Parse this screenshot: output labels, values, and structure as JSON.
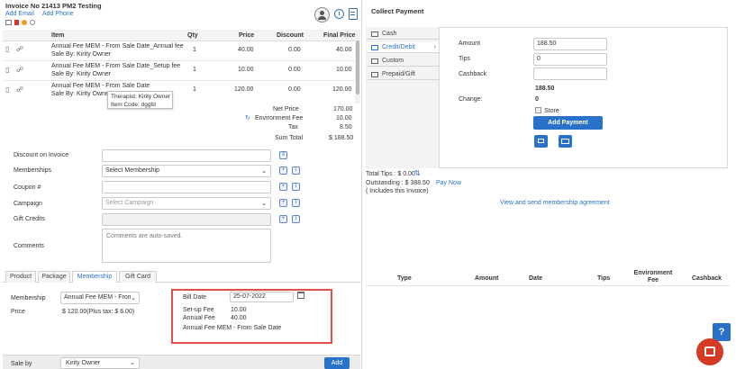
{
  "invoice": {
    "title": "Invoice No 21413  PM2 Testing",
    "add_email": "Add Email",
    "add_phone": "Add Phone"
  },
  "table": {
    "headers": {
      "item": "Item",
      "qty": "Qty",
      "price": "Price",
      "discount": "Discount",
      "final_price": "Final Price"
    },
    "rows": [
      {
        "item": "Annual Fee MEM - From Sale Date_Annual fee",
        "sale_by": "Sale By: Kirity Owner",
        "qty": "1",
        "price": "40.00",
        "discount": "0.00",
        "final": "40.00"
      },
      {
        "item": "Annual Fee MEM - From Sale Date_Setup fee",
        "sale_by": "Sale By: Kirity Owner",
        "qty": "1",
        "price": "10.00",
        "discount": "0.00",
        "final": "10.00"
      },
      {
        "item": "Annual Fee MEM - From Sale Date",
        "sale_by": "Sale By: Kirity Owner",
        "qty": "1",
        "price": "120.00",
        "discount": "0.00",
        "final": "120.00"
      }
    ],
    "tooltip": {
      "line1": "Therapist: Kirity Owner",
      "line2": "Item Code: dggfd"
    }
  },
  "totals": {
    "net_price_label": "Net Price",
    "net_price": "170.00",
    "env_fee_label": "Environment Fee",
    "env_fee": "10.00",
    "tax_label": "Tax",
    "tax": "8.50",
    "sum_total_label": "Sum Total",
    "sum_total": "$ 188.50"
  },
  "form": {
    "discount_label": "Discount on Invoice",
    "memberships_label": "Memberships",
    "memberships_value": "Select Membership",
    "coupon_label": "Coupon #",
    "campaign_label": "Campaign",
    "campaign_placeholder": "Select Campaign",
    "gift_credits_label": "Gift Credits",
    "comments_label": "Comments",
    "comments_placeholder": "Comments are auto-saved."
  },
  "tabs": [
    "Product",
    "Package",
    "Membership",
    "Gift Card"
  ],
  "membership": {
    "membership_label": "Membership",
    "membership_value": "Annual Fee MEM - From",
    "price_label": "Price",
    "price_value": "$ 120.00(Plus tax: $ 6.00)",
    "bill_date_label": "Bill Date",
    "bill_date_value": "25-07-2022",
    "setup_fee_label": "Set-up Fee",
    "setup_fee_value": "10.00",
    "annual_fee_label": "Annual Fee",
    "annual_fee_value": "40.00",
    "plan_name": "Annual Fee MEM - From Sale Date"
  },
  "sale_by": {
    "label": "Sale by",
    "value": "Kirity Owner",
    "add_button": "Add"
  },
  "payment": {
    "title": "Collect Payment",
    "methods": [
      "Cash",
      "Credit/Debit",
      "Custom",
      "Prepaid/Gift"
    ],
    "amount_label": "Amount",
    "amount_value": "188.50",
    "tips_label": "Tips",
    "tips_value": "0",
    "cashback_label": "Cashback",
    "cashback_value": "",
    "total_due": "188.50",
    "change_label": "Change:",
    "change_value": "0",
    "store_label": "Store",
    "add_payment_button": "Add Payment",
    "total_tips": "Total Tips : $ 0.00",
    "outstanding": "Outstanding : $ 388.50",
    "pay_now": "Pay Now",
    "includes_note": "( Includes this Invoice)",
    "view_agreement": "View and send membership agreement",
    "table_headers": [
      "Type",
      "Amount",
      "Date",
      "Tips",
      "Environment Fee",
      "Cashback"
    ]
  },
  "colors": {
    "accent": "#2a72c9",
    "highlight_box": "#e0504a",
    "chat_button": "#d43a24",
    "help_button": "#2a72c9"
  }
}
